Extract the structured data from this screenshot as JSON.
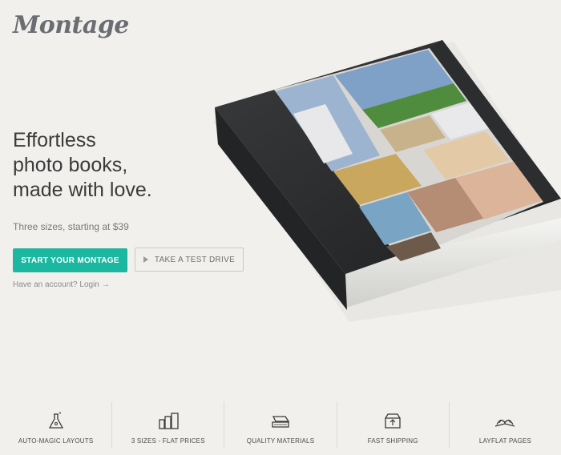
{
  "brand": {
    "logo_text": "Montage"
  },
  "hero": {
    "title_lines": [
      "Effortless",
      "photo books,",
      "made with love."
    ],
    "subtitle": "Three sizes, starting at $39",
    "primary_cta": "START YOUR MONTAGE",
    "secondary_cta": "TAKE A TEST DRIVE",
    "login_text": "Have an account? Login"
  },
  "features": [
    {
      "label": "AUTO-MAGIC LAYOUTS",
      "icon": "flask-icon"
    },
    {
      "label": "3 SIZES - FLAT PRICES",
      "icon": "books-icon"
    },
    {
      "label": "QUALITY MATERIALS",
      "icon": "book-stack-icon"
    },
    {
      "label": "FAST SHIPPING",
      "icon": "shipping-box-icon"
    },
    {
      "label": "LAYFLAT PAGES",
      "icon": "open-book-icon"
    }
  ],
  "colors": {
    "accent": "#1bb7a1",
    "background": "#f1f0ed",
    "text": "#3b3b3b"
  }
}
